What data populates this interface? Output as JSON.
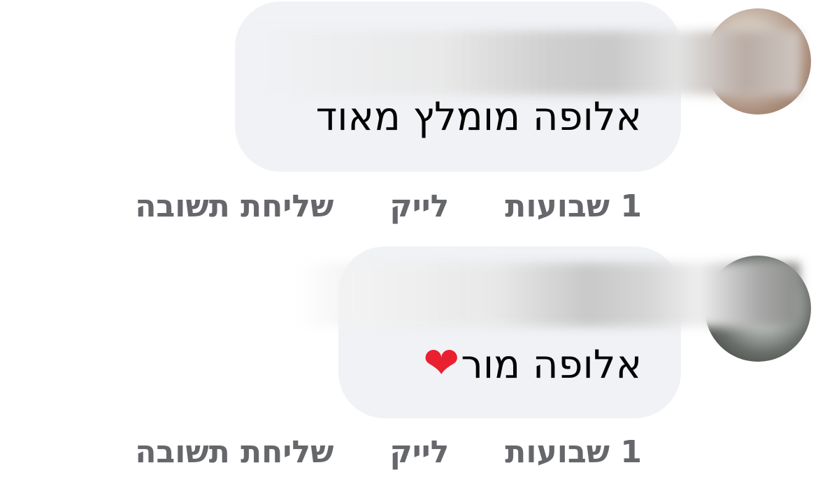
{
  "comments": [
    {
      "text": "אלופה מומלץ מאוד",
      "timestamp": "1 שבועות",
      "like_label": "לייק",
      "reply_label": "שליחת תשובה"
    },
    {
      "text": "אלופה מור",
      "emoji": "❤",
      "timestamp": "1 שבועות",
      "like_label": "לייק",
      "reply_label": "שליחת תשובה"
    }
  ],
  "colors": {
    "bubble_background": "#f0f2f5",
    "text": "#050505",
    "secondary_text": "#65676b",
    "heart": "#e8202f"
  },
  "icons": {
    "reaction_emoji": "heart-emoji-icon"
  }
}
